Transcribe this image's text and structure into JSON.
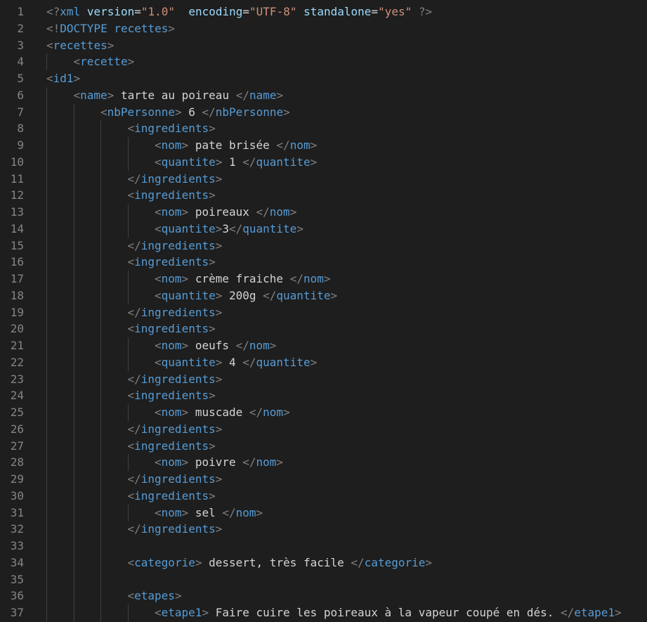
{
  "editor": {
    "language": "xml",
    "colors": {
      "background": "#1e1e1e",
      "line_number": "#858585",
      "punctuation": "#808080",
      "tag": "#569cd6",
      "attribute": "#9cdcfe",
      "string": "#ce9178",
      "text": "#d4d4d4",
      "indent_guide": "#404040"
    },
    "lines": [
      {
        "n": "1",
        "indent": 0,
        "tokens": [
          [
            "punc",
            "<?"
          ],
          [
            "tag",
            "xml"
          ],
          [
            "text",
            " "
          ],
          [
            "attr",
            "version"
          ],
          [
            "text",
            "="
          ],
          [
            "str",
            "\"1.0\""
          ],
          [
            "text",
            "  "
          ],
          [
            "attr",
            "encoding"
          ],
          [
            "text",
            "="
          ],
          [
            "str",
            "\"UTF-8\""
          ],
          [
            "text",
            " "
          ],
          [
            "attr",
            "standalone"
          ],
          [
            "text",
            "="
          ],
          [
            "str",
            "\"yes\""
          ],
          [
            "text",
            " "
          ],
          [
            "punc",
            "?>"
          ]
        ]
      },
      {
        "n": "2",
        "indent": 0,
        "tokens": [
          [
            "punc",
            "<!"
          ],
          [
            "tag",
            "DOCTYPE recettes"
          ],
          [
            "punc",
            ">"
          ]
        ]
      },
      {
        "n": "3",
        "indent": 0,
        "tokens": [
          [
            "punc",
            "<"
          ],
          [
            "tag",
            "recettes"
          ],
          [
            "punc",
            ">"
          ]
        ]
      },
      {
        "n": "4",
        "indent": 1,
        "tokens": [
          [
            "punc",
            "<"
          ],
          [
            "tag",
            "recette"
          ],
          [
            "punc",
            ">"
          ]
        ]
      },
      {
        "n": "5",
        "indent": 0,
        "tokens": [
          [
            "punc",
            "<"
          ],
          [
            "tag",
            "id1"
          ],
          [
            "punc",
            ">"
          ]
        ]
      },
      {
        "n": "6",
        "indent": 1,
        "tokens": [
          [
            "punc",
            "<"
          ],
          [
            "tag",
            "name"
          ],
          [
            "punc",
            ">"
          ],
          [
            "text",
            " tarte au poireau "
          ],
          [
            "punc",
            "</"
          ],
          [
            "tag",
            "name"
          ],
          [
            "punc",
            ">"
          ]
        ]
      },
      {
        "n": "7",
        "indent": 2,
        "tokens": [
          [
            "punc",
            "<"
          ],
          [
            "tag",
            "nbPersonne"
          ],
          [
            "punc",
            ">"
          ],
          [
            "text",
            " 6 "
          ],
          [
            "punc",
            "</"
          ],
          [
            "tag",
            "nbPersonne"
          ],
          [
            "punc",
            ">"
          ]
        ]
      },
      {
        "n": "8",
        "indent": 3,
        "tokens": [
          [
            "punc",
            "<"
          ],
          [
            "tag",
            "ingredients"
          ],
          [
            "punc",
            ">"
          ]
        ]
      },
      {
        "n": "9",
        "indent": 4,
        "tokens": [
          [
            "punc",
            "<"
          ],
          [
            "tag",
            "nom"
          ],
          [
            "punc",
            ">"
          ],
          [
            "text",
            " pate brisée "
          ],
          [
            "punc",
            "</"
          ],
          [
            "tag",
            "nom"
          ],
          [
            "punc",
            ">"
          ]
        ]
      },
      {
        "n": "10",
        "indent": 4,
        "tokens": [
          [
            "punc",
            "<"
          ],
          [
            "tag",
            "quantite"
          ],
          [
            "punc",
            ">"
          ],
          [
            "text",
            " 1 "
          ],
          [
            "punc",
            "</"
          ],
          [
            "tag",
            "quantite"
          ],
          [
            "punc",
            ">"
          ]
        ]
      },
      {
        "n": "11",
        "indent": 3,
        "tokens": [
          [
            "punc",
            "</"
          ],
          [
            "tag",
            "ingredients"
          ],
          [
            "punc",
            ">"
          ]
        ]
      },
      {
        "n": "12",
        "indent": 3,
        "tokens": [
          [
            "punc",
            "<"
          ],
          [
            "tag",
            "ingredients"
          ],
          [
            "punc",
            ">"
          ]
        ]
      },
      {
        "n": "13",
        "indent": 4,
        "tokens": [
          [
            "punc",
            "<"
          ],
          [
            "tag",
            "nom"
          ],
          [
            "punc",
            ">"
          ],
          [
            "text",
            " poireaux "
          ],
          [
            "punc",
            "</"
          ],
          [
            "tag",
            "nom"
          ],
          [
            "punc",
            ">"
          ]
        ]
      },
      {
        "n": "14",
        "indent": 4,
        "tokens": [
          [
            "punc",
            "<"
          ],
          [
            "tag",
            "quantite"
          ],
          [
            "punc",
            ">"
          ],
          [
            "text",
            "3"
          ],
          [
            "punc",
            "</"
          ],
          [
            "tag",
            "quantite"
          ],
          [
            "punc",
            ">"
          ]
        ]
      },
      {
        "n": "15",
        "indent": 3,
        "tokens": [
          [
            "punc",
            "</"
          ],
          [
            "tag",
            "ingredients"
          ],
          [
            "punc",
            ">"
          ]
        ]
      },
      {
        "n": "16",
        "indent": 3,
        "tokens": [
          [
            "punc",
            "<"
          ],
          [
            "tag",
            "ingredients"
          ],
          [
            "punc",
            ">"
          ]
        ]
      },
      {
        "n": "17",
        "indent": 4,
        "tokens": [
          [
            "punc",
            "<"
          ],
          [
            "tag",
            "nom"
          ],
          [
            "punc",
            ">"
          ],
          [
            "text",
            " crème fraiche "
          ],
          [
            "punc",
            "</"
          ],
          [
            "tag",
            "nom"
          ],
          [
            "punc",
            ">"
          ]
        ]
      },
      {
        "n": "18",
        "indent": 4,
        "tokens": [
          [
            "punc",
            "<"
          ],
          [
            "tag",
            "quantite"
          ],
          [
            "punc",
            ">"
          ],
          [
            "text",
            " 200g "
          ],
          [
            "punc",
            "</"
          ],
          [
            "tag",
            "quantite"
          ],
          [
            "punc",
            ">"
          ]
        ]
      },
      {
        "n": "19",
        "indent": 3,
        "tokens": [
          [
            "punc",
            "</"
          ],
          [
            "tag",
            "ingredients"
          ],
          [
            "punc",
            ">"
          ]
        ]
      },
      {
        "n": "20",
        "indent": 3,
        "tokens": [
          [
            "punc",
            "<"
          ],
          [
            "tag",
            "ingredients"
          ],
          [
            "punc",
            ">"
          ]
        ]
      },
      {
        "n": "21",
        "indent": 4,
        "tokens": [
          [
            "punc",
            "<"
          ],
          [
            "tag",
            "nom"
          ],
          [
            "punc",
            ">"
          ],
          [
            "text",
            " oeufs "
          ],
          [
            "punc",
            "</"
          ],
          [
            "tag",
            "nom"
          ],
          [
            "punc",
            ">"
          ]
        ]
      },
      {
        "n": "22",
        "indent": 4,
        "tokens": [
          [
            "punc",
            "<"
          ],
          [
            "tag",
            "quantite"
          ],
          [
            "punc",
            ">"
          ],
          [
            "text",
            " 4 "
          ],
          [
            "punc",
            "</"
          ],
          [
            "tag",
            "quantite"
          ],
          [
            "punc",
            ">"
          ]
        ]
      },
      {
        "n": "23",
        "indent": 3,
        "tokens": [
          [
            "punc",
            "</"
          ],
          [
            "tag",
            "ingredients"
          ],
          [
            "punc",
            ">"
          ]
        ]
      },
      {
        "n": "24",
        "indent": 3,
        "tokens": [
          [
            "punc",
            "<"
          ],
          [
            "tag",
            "ingredients"
          ],
          [
            "punc",
            ">"
          ]
        ]
      },
      {
        "n": "25",
        "indent": 4,
        "tokens": [
          [
            "punc",
            "<"
          ],
          [
            "tag",
            "nom"
          ],
          [
            "punc",
            ">"
          ],
          [
            "text",
            " muscade "
          ],
          [
            "punc",
            "</"
          ],
          [
            "tag",
            "nom"
          ],
          [
            "punc",
            ">"
          ]
        ]
      },
      {
        "n": "26",
        "indent": 3,
        "tokens": [
          [
            "punc",
            "</"
          ],
          [
            "tag",
            "ingredients"
          ],
          [
            "punc",
            ">"
          ]
        ]
      },
      {
        "n": "27",
        "indent": 3,
        "tokens": [
          [
            "punc",
            "<"
          ],
          [
            "tag",
            "ingredients"
          ],
          [
            "punc",
            ">"
          ]
        ]
      },
      {
        "n": "28",
        "indent": 4,
        "tokens": [
          [
            "punc",
            "<"
          ],
          [
            "tag",
            "nom"
          ],
          [
            "punc",
            ">"
          ],
          [
            "text",
            " poivre "
          ],
          [
            "punc",
            "</"
          ],
          [
            "tag",
            "nom"
          ],
          [
            "punc",
            ">"
          ]
        ]
      },
      {
        "n": "29",
        "indent": 3,
        "tokens": [
          [
            "punc",
            "</"
          ],
          [
            "tag",
            "ingredients"
          ],
          [
            "punc",
            ">"
          ]
        ]
      },
      {
        "n": "30",
        "indent": 3,
        "tokens": [
          [
            "punc",
            "<"
          ],
          [
            "tag",
            "ingredients"
          ],
          [
            "punc",
            ">"
          ]
        ]
      },
      {
        "n": "31",
        "indent": 4,
        "tokens": [
          [
            "punc",
            "<"
          ],
          [
            "tag",
            "nom"
          ],
          [
            "punc",
            ">"
          ],
          [
            "text",
            " sel "
          ],
          [
            "punc",
            "</"
          ],
          [
            "tag",
            "nom"
          ],
          [
            "punc",
            ">"
          ]
        ]
      },
      {
        "n": "32",
        "indent": 3,
        "tokens": [
          [
            "punc",
            "</"
          ],
          [
            "tag",
            "ingredients"
          ],
          [
            "punc",
            ">"
          ]
        ]
      },
      {
        "n": "33",
        "indent": 3,
        "tokens": []
      },
      {
        "n": "34",
        "indent": 3,
        "tokens": [
          [
            "punc",
            "<"
          ],
          [
            "tag",
            "categorie"
          ],
          [
            "punc",
            ">"
          ],
          [
            "text",
            " dessert, très facile "
          ],
          [
            "punc",
            "</"
          ],
          [
            "tag",
            "categorie"
          ],
          [
            "punc",
            ">"
          ]
        ]
      },
      {
        "n": "35",
        "indent": 3,
        "tokens": []
      },
      {
        "n": "36",
        "indent": 3,
        "tokens": [
          [
            "punc",
            "<"
          ],
          [
            "tag",
            "etapes"
          ],
          [
            "punc",
            ">"
          ]
        ]
      },
      {
        "n": "37",
        "indent": 4,
        "tokens": [
          [
            "punc",
            "<"
          ],
          [
            "tag",
            "etape1"
          ],
          [
            "punc",
            ">"
          ],
          [
            "text",
            " Faire cuire les poireaux à la vapeur coupé en dés. "
          ],
          [
            "punc",
            "</"
          ],
          [
            "tag",
            "etape1"
          ],
          [
            "punc",
            ">"
          ]
        ]
      }
    ]
  }
}
